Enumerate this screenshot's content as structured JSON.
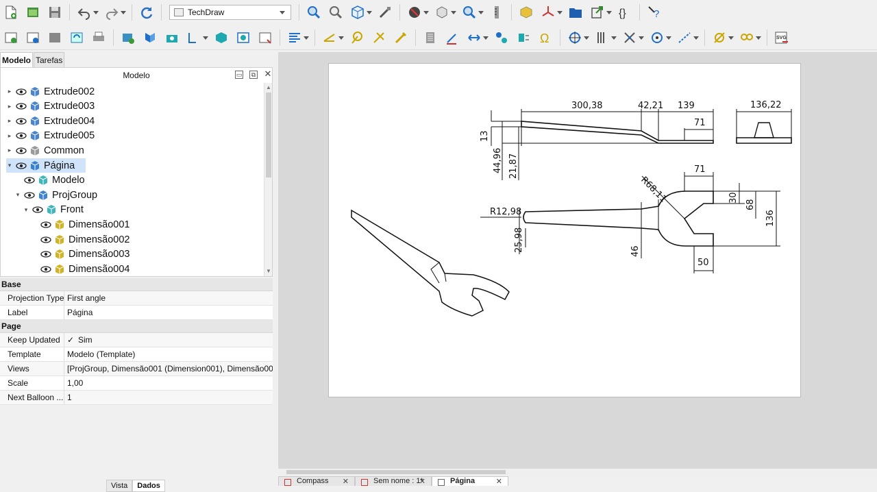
{
  "workbench": {
    "selected": "TechDraw"
  },
  "toolbar": {
    "row1": [
      "new-file",
      "open-file",
      "save-file",
      "undo",
      "redo",
      "refresh",
      "zoom-fit",
      "zoom",
      "view-cube",
      "measure",
      "draw-style",
      "std-views",
      "zoom-box",
      "measure-tool",
      "part",
      "axis",
      "folder",
      "export",
      "macro",
      "whats-this"
    ],
    "row2": [
      "techdraw-page",
      "insert-template",
      "redraw",
      "print",
      "insert-view",
      "projection-group",
      "section",
      "detail-view",
      "clip",
      "symbol",
      "export-svg"
    ]
  },
  "left_panel": {
    "tabs": [
      "Modelo",
      "Tarefas"
    ],
    "active_tab": "Modelo",
    "tree_title": "Modelo",
    "tree_items": [
      {
        "label": "Extrude002",
        "icon": "extrude-icon",
        "depth": 0,
        "arrow": "▸"
      },
      {
        "label": "Extrude003",
        "icon": "extrude-icon",
        "depth": 0,
        "arrow": "▸"
      },
      {
        "label": "Extrude004",
        "icon": "extrude-icon",
        "depth": 0,
        "arrow": "▸"
      },
      {
        "label": "Extrude005",
        "icon": "extrude-icon",
        "depth": 0,
        "arrow": "▸"
      },
      {
        "label": "Common",
        "icon": "common-icon",
        "depth": 0,
        "arrow": "▸"
      },
      {
        "label": "Página",
        "icon": "page-icon",
        "depth": 0,
        "arrow": "▾",
        "selected": true
      },
      {
        "label": "Modelo",
        "icon": "template-icon",
        "depth": 1,
        "arrow": ""
      },
      {
        "label": "ProjGroup",
        "icon": "projgroup-icon",
        "depth": 1,
        "arrow": "▾"
      },
      {
        "label": "Front",
        "icon": "view-icon",
        "depth": 2,
        "arrow": "▾"
      },
      {
        "label": "Dimensão001",
        "icon": "dimension-icon",
        "depth": 3,
        "arrow": ""
      },
      {
        "label": "Dimensão002",
        "icon": "dimension-icon",
        "depth": 3,
        "arrow": ""
      },
      {
        "label": "Dimensão003",
        "icon": "dimension-icon",
        "depth": 3,
        "arrow": ""
      },
      {
        "label": "Dimensão004",
        "icon": "dimension-icon",
        "depth": 3,
        "arrow": ""
      }
    ],
    "properties": [
      {
        "group": "Base",
        "rows": [
          {
            "name": "Projection Type",
            "value": "First angle"
          },
          {
            "name": "Label",
            "value": "Página"
          }
        ]
      },
      {
        "group": "Page",
        "rows": [
          {
            "name": "Keep Updated",
            "value": "Sim",
            "checkbox": true
          },
          {
            "name": "Template",
            "value": "Modelo (Template)"
          },
          {
            "name": "Views",
            "value": "[ProjGroup, Dimensão001 (Dimension001), Dimensão00..."
          },
          {
            "name": "Scale",
            "value": "1,00"
          },
          {
            "name": "Next Balloon ...",
            "value": "1"
          }
        ]
      }
    ],
    "bottom_tabs": [
      "Vista",
      "Dados"
    ]
  },
  "drawing": {
    "dims": {
      "d300": "300,38",
      "d42": "42,21",
      "d139": "139",
      "d136_22": "136,22",
      "d71a": "71",
      "d13": "13",
      "d44": "44,96",
      "d21": "21,87",
      "dR68": "R68,11",
      "d71b": "71",
      "dR12": "R12,98",
      "d25": "25,98",
      "d46": "46",
      "d30": "30",
      "d68": "68",
      "d136": "136",
      "d50": "50"
    }
  },
  "doc_tabs": [
    {
      "label": "Compass",
      "icon": "doc-icon"
    },
    {
      "label": "Sem nome : 1*",
      "icon": "doc-icon"
    },
    {
      "label": "Página",
      "icon": "page-icon",
      "active": true
    }
  ],
  "colors": {
    "selection": "#cfe4fb",
    "view_bg": "#d8d8d8",
    "accent_blue": "#1e6fc8"
  }
}
